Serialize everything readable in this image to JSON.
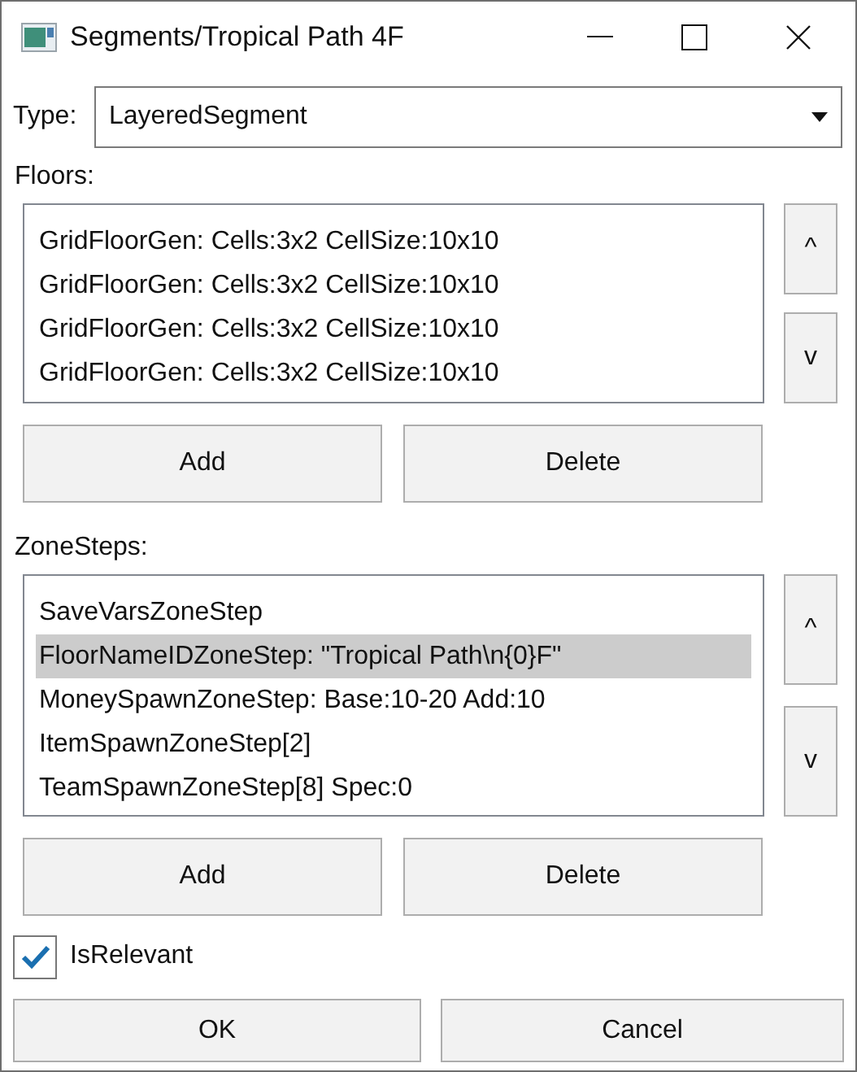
{
  "window": {
    "title": "Segments/Tropical Path 4F"
  },
  "type_field": {
    "label": "Type:",
    "value": "LayeredSegment"
  },
  "floors": {
    "label": "Floors:",
    "items": [
      {
        "text": "GridFloorGen: Cells:3x2 CellSize:10x10",
        "selected": false
      },
      {
        "text": "GridFloorGen: Cells:3x2 CellSize:10x10",
        "selected": false
      },
      {
        "text": "GridFloorGen: Cells:3x2 CellSize:10x10",
        "selected": false
      },
      {
        "text": "GridFloorGen: Cells:3x2 CellSize:10x10",
        "selected": false
      }
    ],
    "up_button": "^",
    "down_button": "v",
    "add_button": "Add",
    "delete_button": "Delete"
  },
  "zone_steps": {
    "label": "ZoneSteps:",
    "items": [
      {
        "text": "SaveVarsZoneStep",
        "selected": false
      },
      {
        "text": "FloorNameIDZoneStep: \"Tropical Path\\n{0}F\"",
        "selected": true
      },
      {
        "text": "MoneySpawnZoneStep: Base:10-20 Add:10",
        "selected": false
      },
      {
        "text": "ItemSpawnZoneStep[2]",
        "selected": false
      },
      {
        "text": "TeamSpawnZoneStep[8] Spec:0",
        "selected": false
      }
    ],
    "up_button": "^",
    "down_button": "v",
    "add_button": "Add",
    "delete_button": "Delete"
  },
  "is_relevant": {
    "label": "IsRelevant",
    "checked": true
  },
  "buttons": [
    "OK",
    "Cancel"
  ]
}
